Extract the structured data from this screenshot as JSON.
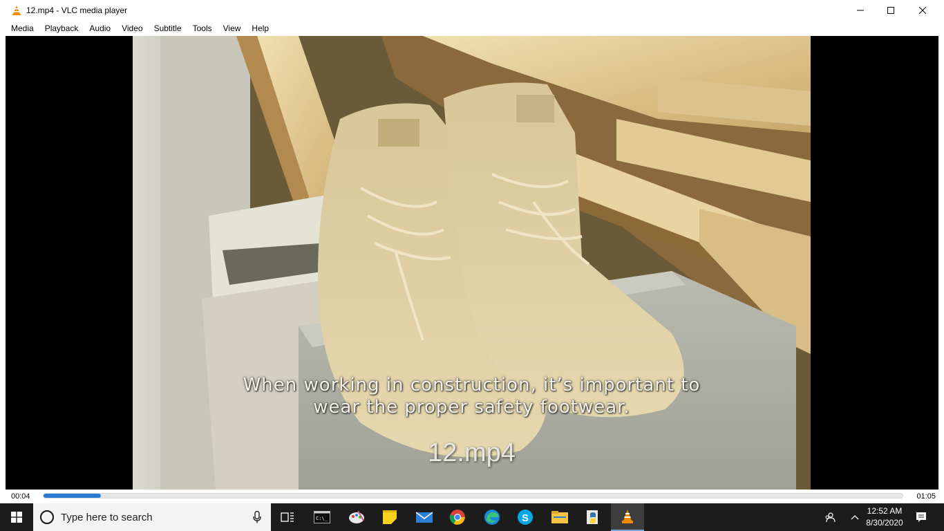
{
  "window": {
    "title": "12.mp4 - VLC media player"
  },
  "menu": [
    "Media",
    "Playback",
    "Audio",
    "Video",
    "Subtitle",
    "Tools",
    "View",
    "Help"
  ],
  "video": {
    "subtitle_line1": "When working in construction, it’s important to",
    "subtitle_line2": "wear the proper safety footwear.",
    "filename_overlay": "12.mp4"
  },
  "playback": {
    "elapsed": "00:04",
    "total": "01:05",
    "progress_percent": 6.7
  },
  "taskbar": {
    "search_placeholder": "Type here to search",
    "clock_time": "12:52 AM",
    "clock_date": "8/30/2020",
    "pinned_icons": [
      "task-view-icon",
      "terminal-icon",
      "paint-icon",
      "sticky-notes-icon",
      "mail-icon",
      "chrome-icon",
      "edge-icon",
      "skype-icon",
      "file-explorer-icon",
      "python-icon",
      "vlc-icon"
    ]
  },
  "colors": {
    "accent": "#2a7bd4",
    "taskbar": "#1c1c1c",
    "vlc_orange": "#f08a00"
  }
}
